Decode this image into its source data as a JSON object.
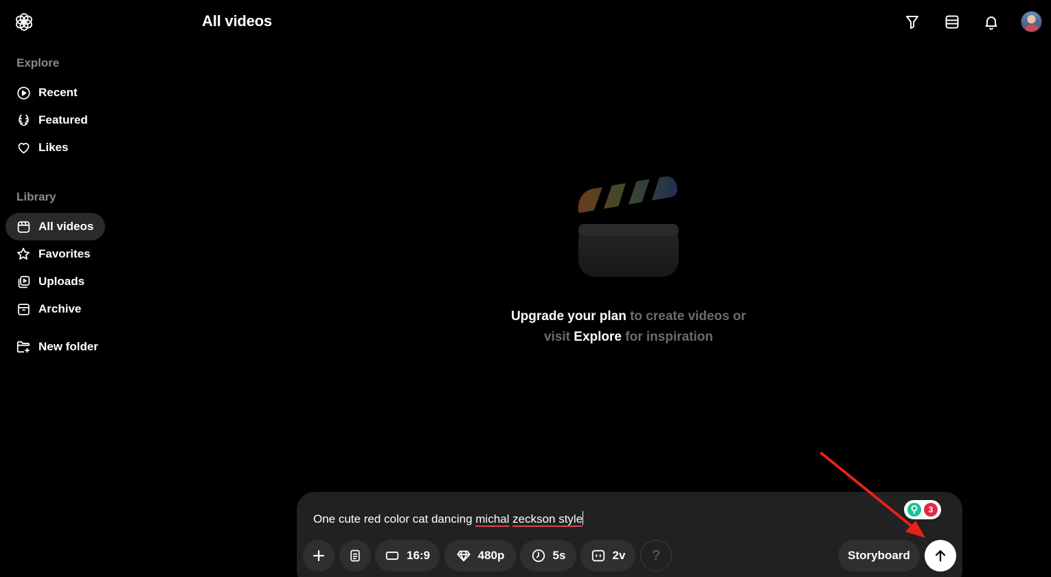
{
  "header": {
    "title": "All videos",
    "actions": [
      {
        "icon": "filter-icon"
      },
      {
        "icon": "layout-list-icon"
      },
      {
        "icon": "bell-icon"
      }
    ]
  },
  "sidebar": {
    "explore_title": "Explore",
    "explore_items": [
      {
        "label": "Recent",
        "icon": "play-circle-icon"
      },
      {
        "label": "Featured",
        "icon": "laurel-icon"
      },
      {
        "label": "Likes",
        "icon": "heart-icon"
      }
    ],
    "library_title": "Library",
    "library_items": [
      {
        "label": "All videos",
        "icon": "video-frame-icon",
        "active": true
      },
      {
        "label": "Favorites",
        "icon": "star-icon"
      },
      {
        "label": "Uploads",
        "icon": "upload-play-icon"
      },
      {
        "label": "Archive",
        "icon": "archive-icon"
      }
    ],
    "new_folder_label": "New folder"
  },
  "empty_state": {
    "line1_highlight": "Upgrade your plan",
    "line1_rest": " to create videos or",
    "line2_pre": "visit ",
    "line2_highlight": "Explore",
    "line2_rest": " for inspiration"
  },
  "composer": {
    "prompt_plain": "One cute red color cat dancing ",
    "prompt_word1": "michal",
    "prompt_space": " ",
    "prompt_word2": "zeckson style",
    "grammarly_count": "3",
    "options": {
      "aspect": "16:9",
      "resolution": "480p",
      "duration": "5s",
      "variations": "2v",
      "help": "?"
    },
    "storyboard_label": "Storyboard"
  },
  "colors": {
    "background": "#000000",
    "composer_bg": "#212121",
    "pill_bg": "#2f2f2f",
    "annotation_arrow": "#e8211b",
    "spell_underline": "#e0405a"
  }
}
